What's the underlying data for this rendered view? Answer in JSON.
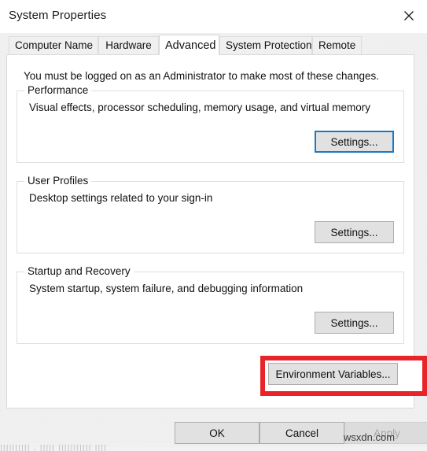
{
  "window": {
    "title": "System Properties",
    "close_icon": "close-icon",
    "close_label": "Close"
  },
  "tabs": [
    {
      "label": "Computer Name",
      "selected": false
    },
    {
      "label": "Hardware",
      "selected": false
    },
    {
      "label": "Advanced",
      "selected": true
    },
    {
      "label": "System Protection",
      "selected": false
    },
    {
      "label": "Remote",
      "selected": false
    }
  ],
  "advanced": {
    "intro": "You must be logged on as an Administrator to make most of these changes.",
    "groups": [
      {
        "legend": "Performance",
        "description": "Visual effects, processor scheduling, memory usage, and virtual memory",
        "button_label": "Settings...",
        "button_focused": true
      },
      {
        "legend": "User Profiles",
        "description": "Desktop settings related to your sign-in",
        "button_label": "Settings...",
        "button_focused": false
      },
      {
        "legend": "Startup and Recovery",
        "description": "System startup, system failure, and debugging information",
        "button_label": "Settings...",
        "button_focused": false
      }
    ],
    "environment_variables_label": "Environment Variables..."
  },
  "footer": {
    "ok_label": "OK",
    "cancel_label": "Cancel",
    "apply_label": "Apply",
    "apply_disabled": true
  },
  "annotation": {
    "highlight_color": "#e8232a",
    "focus_color": "#1a79c4"
  },
  "watermark": {
    "text": "wsxdn.com"
  },
  "artifact": {
    "text": "|||||||||| . ||||| ||||||||||| ||||"
  }
}
